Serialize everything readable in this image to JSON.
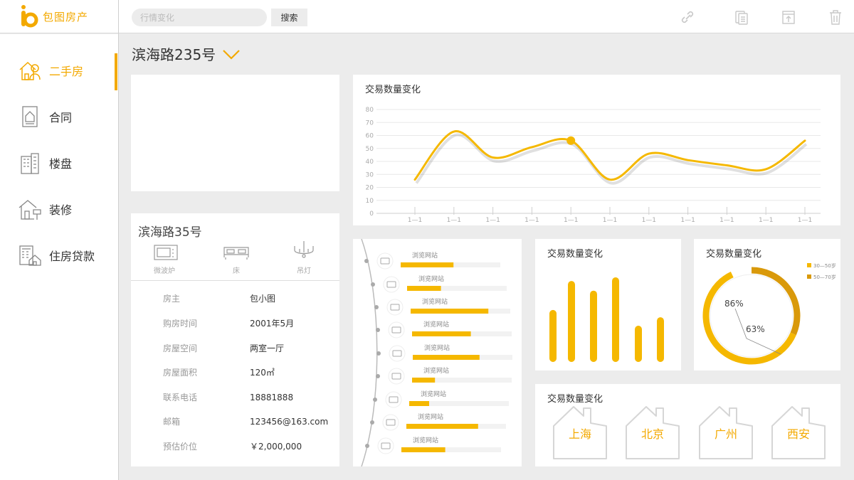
{
  "app": {
    "name": "包图房产"
  },
  "search": {
    "placeholder": "行情变化",
    "button": "搜索"
  },
  "nav": [
    {
      "label": "二手房",
      "icon": "second-hand-house-icon",
      "active": true
    },
    {
      "label": "合同",
      "icon": "contract-icon",
      "active": false
    },
    {
      "label": "楼盘",
      "icon": "building-icon",
      "active": false
    },
    {
      "label": "装修",
      "icon": "decoration-icon",
      "active": false
    },
    {
      "label": "住房贷款",
      "icon": "loan-icon",
      "active": false
    }
  ],
  "address": "滨海路235号",
  "property": {
    "title": "滨海路35号",
    "amenities": [
      "微波炉",
      "床",
      "吊灯"
    ],
    "rows": [
      {
        "k": "房主",
        "v": "包小图"
      },
      {
        "k": "购房时间",
        "v": "2001年5月"
      },
      {
        "k": "房屋空间",
        "v": "两室一厅"
      },
      {
        "k": "房屋面积",
        "v": "120㎡"
      },
      {
        "k": "联系电话",
        "v": "18881888"
      },
      {
        "k": "邮箱",
        "v": "123456@163.com"
      },
      {
        "k": "预估价位",
        "v": "￥2,000,000"
      }
    ]
  },
  "colors": {
    "accent": "#f5b800",
    "accent_dark": "#d9990a",
    "grid": "#e8e8e8"
  },
  "list": {
    "label": "浏览网站",
    "items": [
      {
        "fraction": 0.53
      },
      {
        "fraction": 0.34
      },
      {
        "fraction": 0.78
      },
      {
        "fraction": 0.59
      },
      {
        "fraction": 0.67
      },
      {
        "fraction": 0.23
      },
      {
        "fraction": 0.2
      },
      {
        "fraction": 0.72
      },
      {
        "fraction": 0.44
      }
    ]
  },
  "chart_data": [
    {
      "type": "line",
      "title": "交易数量变化",
      "categories": [
        "1—1",
        "1—1",
        "1—1",
        "1—1",
        "1—1",
        "1—1",
        "1—1",
        "1—1",
        "1—1",
        "1—1",
        "1—1"
      ],
      "values": [
        26,
        63,
        43,
        51,
        56,
        26,
        46,
        41,
        37,
        34,
        56
      ],
      "highlight_index": 4,
      "yticks": [
        0,
        10,
        20,
        30,
        40,
        50,
        60,
        70,
        80
      ],
      "ylim": [
        0,
        80
      ],
      "grid": true
    },
    {
      "type": "bar",
      "title": "交易数量变化",
      "values": [
        43,
        67,
        59,
        70,
        30,
        37
      ],
      "ylim": [
        0,
        80
      ]
    },
    {
      "type": "pie",
      "title": "交易数量变化",
      "series": [
        {
          "name": "30—50岁",
          "value": 86,
          "label": "86%"
        },
        {
          "name": "50—70岁",
          "value": 63,
          "label": "63%"
        }
      ],
      "legend": "top-right"
    }
  ],
  "cities": {
    "title": "交易数量变化",
    "items": [
      "上海",
      "北京",
      "广州",
      "西安"
    ]
  }
}
